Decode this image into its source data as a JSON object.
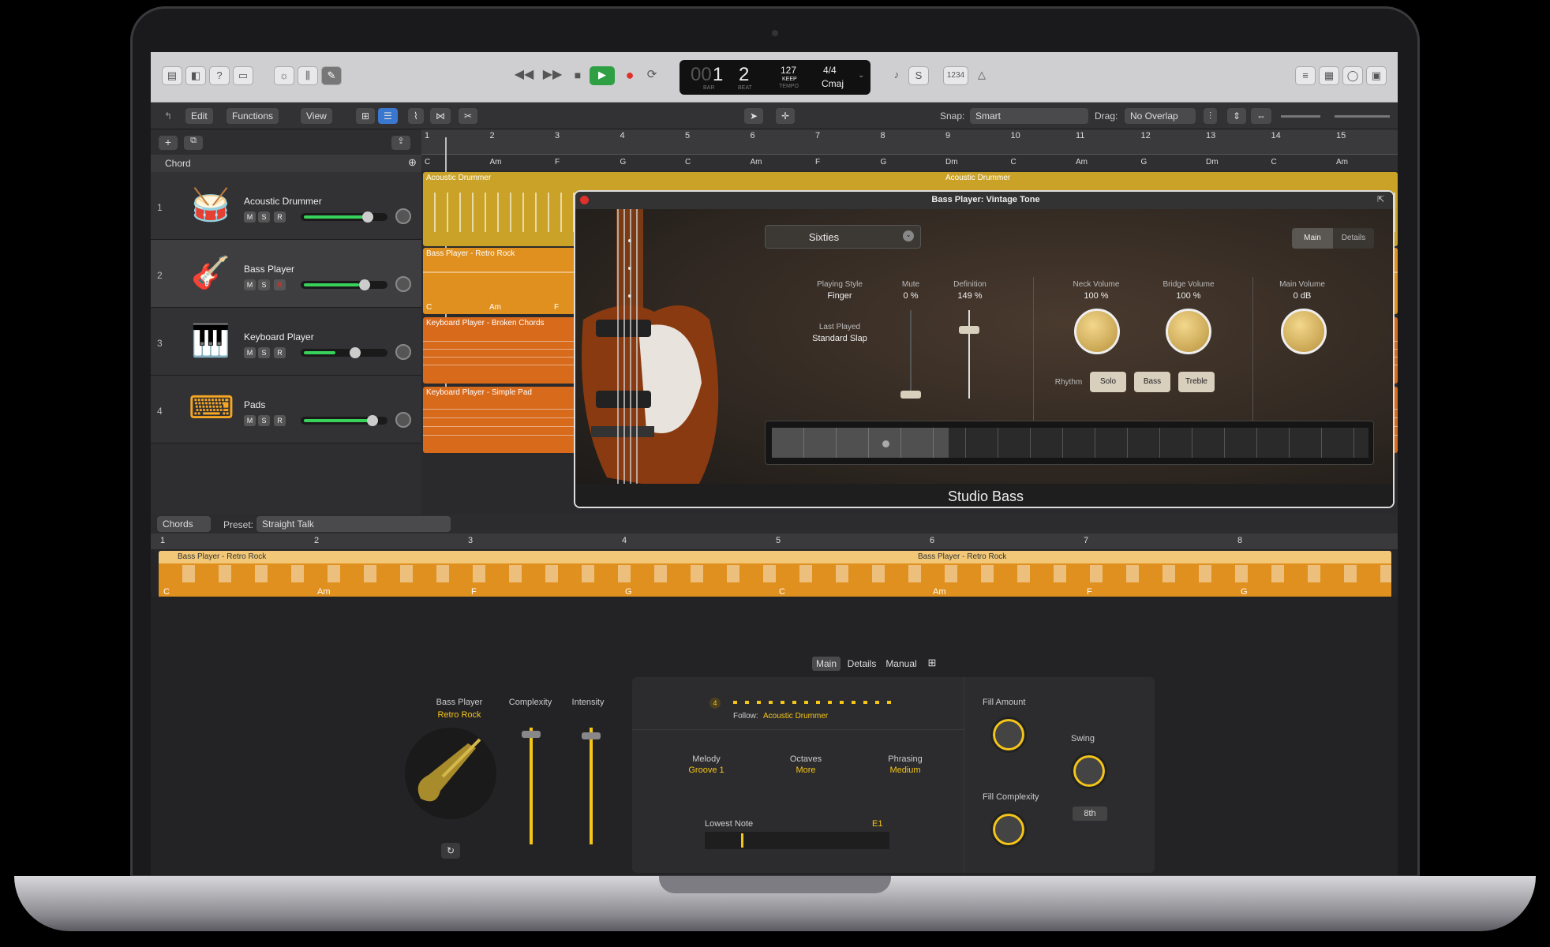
{
  "toolbar": {
    "lcd": {
      "bar": "1",
      "beat": "2",
      "bar_prefix": "00",
      "bar_label": "BAR",
      "beat_label": "BEAT",
      "tempo": "127",
      "keep": "KEEP",
      "tempo_label": "TEMPO",
      "signature": "4/4",
      "key": "Cmaj"
    },
    "count_in": "1234"
  },
  "editbar": {
    "edit": "Edit",
    "functions": "Functions",
    "view": "View",
    "snap_label": "Snap:",
    "snap_value": "Smart",
    "drag_label": "Drag:",
    "drag_value": "No Overlap"
  },
  "track_header": {
    "chord_label": "Chord"
  },
  "ruler": [
    "1",
    "2",
    "3",
    "4",
    "5",
    "6",
    "7",
    "8",
    "9",
    "10",
    "11",
    "12",
    "13",
    "14",
    "15"
  ],
  "chord_row": [
    "C",
    "Am",
    "F",
    "G",
    "C",
    "Am",
    "F",
    "G",
    "Dm",
    "C",
    "Am",
    "G",
    "Dm",
    "C",
    "Am"
  ],
  "tracks": [
    {
      "num": "1",
      "name": "Acoustic Drummer",
      "icon": "drum-kit-icon",
      "region": "Acoustic Drummer",
      "region2": "Acoustic Drummer"
    },
    {
      "num": "2",
      "name": "Bass Player",
      "icon": "bass-guitar-icon",
      "region": "Bass Player - Retro Rock"
    },
    {
      "num": "3",
      "name": "Keyboard Player",
      "icon": "piano-icon",
      "region": "Keyboard Player - Broken Chords"
    },
    {
      "num": "4",
      "name": "Pads",
      "icon": "keyboard-stand-icon",
      "region": "Keyboard Player - Simple Pad"
    }
  ],
  "msr": {
    "m": "M",
    "s": "S",
    "r": "R"
  },
  "track2_chords": [
    "C",
    "Am",
    "F"
  ],
  "plugin": {
    "title": "Bass Player: Vintage Tone",
    "preset": "Sixties",
    "tab_main": "Main",
    "tab_details": "Details",
    "playing_style_label": "Playing Style",
    "playing_style_value": "Finger",
    "last_played_label": "Last Played",
    "last_played_value": "Standard Slap",
    "mute_label": "Mute",
    "mute_value": "0 %",
    "definition_label": "Definition",
    "definition_value": "149 %",
    "neck_label": "Neck Volume",
    "neck_value": "100 %",
    "bridge_label": "Bridge Volume",
    "bridge_value": "100 %",
    "main_label": "Main Volume",
    "main_value": "0 dB",
    "rhythm": "Rhythm",
    "solo": "Solo",
    "bass": "Bass",
    "treble": "Treble",
    "footer": "Studio Bass"
  },
  "chords_bar": {
    "chords": "Chords",
    "preset_label": "Preset:",
    "preset_value": "Straight Talk"
  },
  "editor_ruler": [
    "1",
    "2",
    "3",
    "4",
    "5",
    "6",
    "7",
    "8"
  ],
  "editor_region": {
    "label": "Bass Player - Retro Rock",
    "label2": "Bass Player - Retro Rock",
    "chords": [
      "C",
      "Am",
      "F",
      "G",
      "C",
      "Am",
      "F",
      "G"
    ]
  },
  "session": {
    "tabs": {
      "main": "Main",
      "details": "Details",
      "manual": "Manual"
    },
    "player_label": "Bass Player",
    "player_style": "Retro Rock",
    "complexity": "Complexity",
    "intensity": "Intensity",
    "pattern_num": "4",
    "follow_label": "Follow:",
    "follow_value": "Acoustic Drummer",
    "melody_label": "Melody",
    "melody_value": "Groove 1",
    "octaves_label": "Octaves",
    "octaves_value": "More",
    "phrasing_label": "Phrasing",
    "phrasing_value": "Medium",
    "lowest_note_label": "Lowest Note",
    "lowest_note_value": "E1",
    "fill_amount": "Fill Amount",
    "fill_complexity": "Fill Complexity",
    "swing": "Swing",
    "swing_value": "8th"
  },
  "colors": {
    "accent": "#f5c518",
    "drum_region": "#c9a227",
    "bass_region": "#e0901e",
    "keys_region": "#d86a1c",
    "play": "#2ea043",
    "record": "#e0302a"
  }
}
